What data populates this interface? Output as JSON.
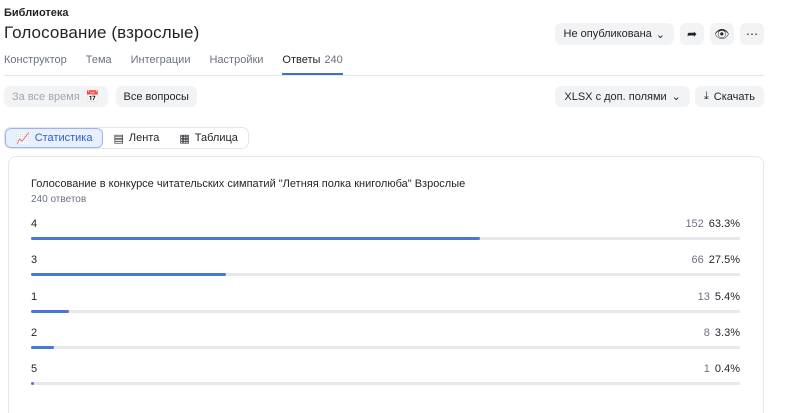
{
  "breadcrumb": "Библиотека",
  "title": "Голосование (взрослые)",
  "publish_status": "Не опубликована",
  "icons": {
    "share": "share-icon",
    "preview": "eye-icon",
    "more": "more-dots-icon"
  },
  "tabs": [
    {
      "label": "Конструктор"
    },
    {
      "label": "Тема"
    },
    {
      "label": "Интеграции"
    },
    {
      "label": "Настройки"
    },
    {
      "label": "Ответы",
      "count": "240"
    }
  ],
  "filters": {
    "period": "За все время",
    "questions": "Все вопросы"
  },
  "export": {
    "format": "XLSX с доп. полями",
    "download": "Скачать"
  },
  "views": {
    "stats": "Статистика",
    "feed": "Лента",
    "table": "Таблица"
  },
  "question": {
    "title": "Голосование в конкурсе читательских симпатий \"Летняя полка книголюба\" Взрослые",
    "responses": "240 ответов",
    "options": [
      {
        "label": "4",
        "count": "152",
        "percent": "63.3%",
        "share": 0.633
      },
      {
        "label": "3",
        "count": "66",
        "percent": "27.5%",
        "share": 0.275
      },
      {
        "label": "1",
        "count": "13",
        "percent": "5.4%",
        "share": 0.054
      },
      {
        "label": "2",
        "count": "8",
        "percent": "3.3%",
        "share": 0.033
      },
      {
        "label": "5",
        "count": "1",
        "percent": "0.4%",
        "share": 0.004
      }
    ]
  },
  "colors": {
    "accent": "#4b78d6",
    "track": "#e6e8ec"
  }
}
